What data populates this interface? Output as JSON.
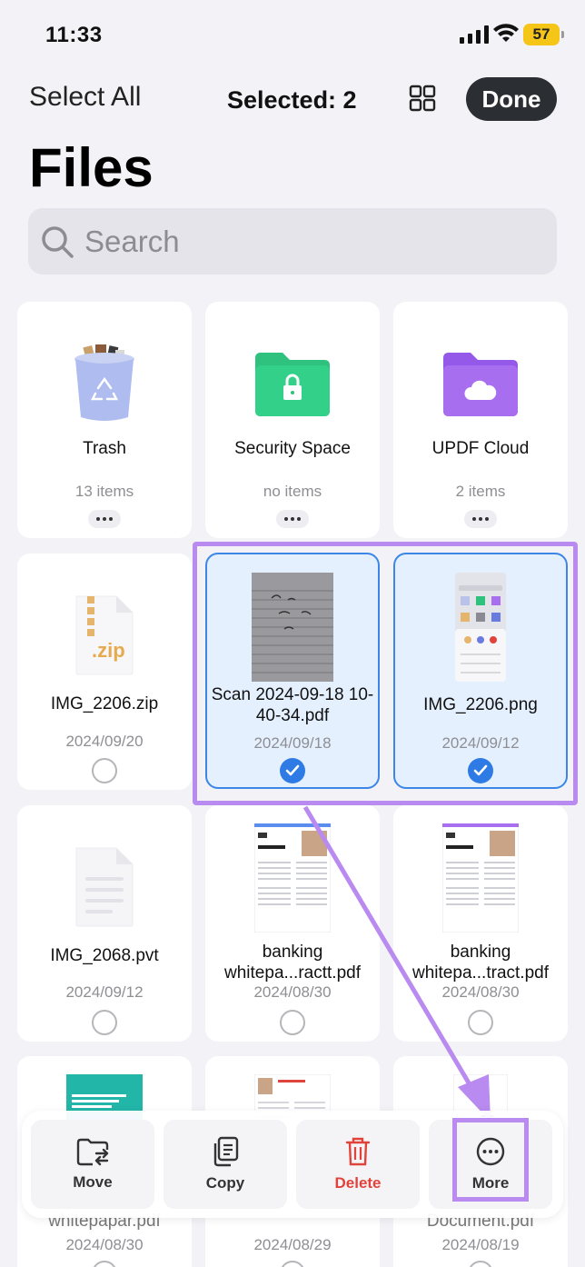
{
  "status_bar": {
    "time": "11:33",
    "battery": "57"
  },
  "nav": {
    "select_all": "Select All",
    "selected": "Selected: 2",
    "done": "Done"
  },
  "page": {
    "title": "Files"
  },
  "search": {
    "placeholder": "Search"
  },
  "items": [
    {
      "name": "Trash",
      "meta": "13 items",
      "icon": "trash-icon"
    },
    {
      "name": "Security Space",
      "meta": "no items",
      "icon": "folder-lock-icon"
    },
    {
      "name": "UPDF Cloud",
      "meta": "2 items",
      "icon": "cloud-folder-icon"
    },
    {
      "name": "IMG_2206.zip",
      "meta": "2024/09/20",
      "icon": "zip-file-icon",
      "zip_label": ".zip"
    },
    {
      "name": "Scan 2024-09-18 10-40-34.pdf",
      "meta": "2024/09/18",
      "selected": true
    },
    {
      "name": "IMG_2206.png",
      "meta": "2024/09/12",
      "selected": true
    },
    {
      "name": "IMG_2068.pvt",
      "meta": "2024/09/12",
      "icon": "document-icon"
    },
    {
      "name": "banking whitepa...ractt.pdf",
      "meta": "2024/08/30"
    },
    {
      "name": "banking whitepa...tract.pdf",
      "meta": "2024/08/30"
    },
    {
      "name": "whitepapar.pdf",
      "meta": "2024/08/30"
    },
    {
      "name": "",
      "meta": "2024/08/29"
    },
    {
      "name": "Document.pdf",
      "meta": "2024/08/19"
    }
  ],
  "toolbar": {
    "move": "Move",
    "copy": "Copy",
    "delete": "Delete",
    "more": "More"
  },
  "colors": {
    "accent": "#2f7be6",
    "highlight": "#b98af0",
    "delete": "#e0433b",
    "security_folder": "#2ec27e",
    "cloud_folder": "#a86ef0"
  }
}
